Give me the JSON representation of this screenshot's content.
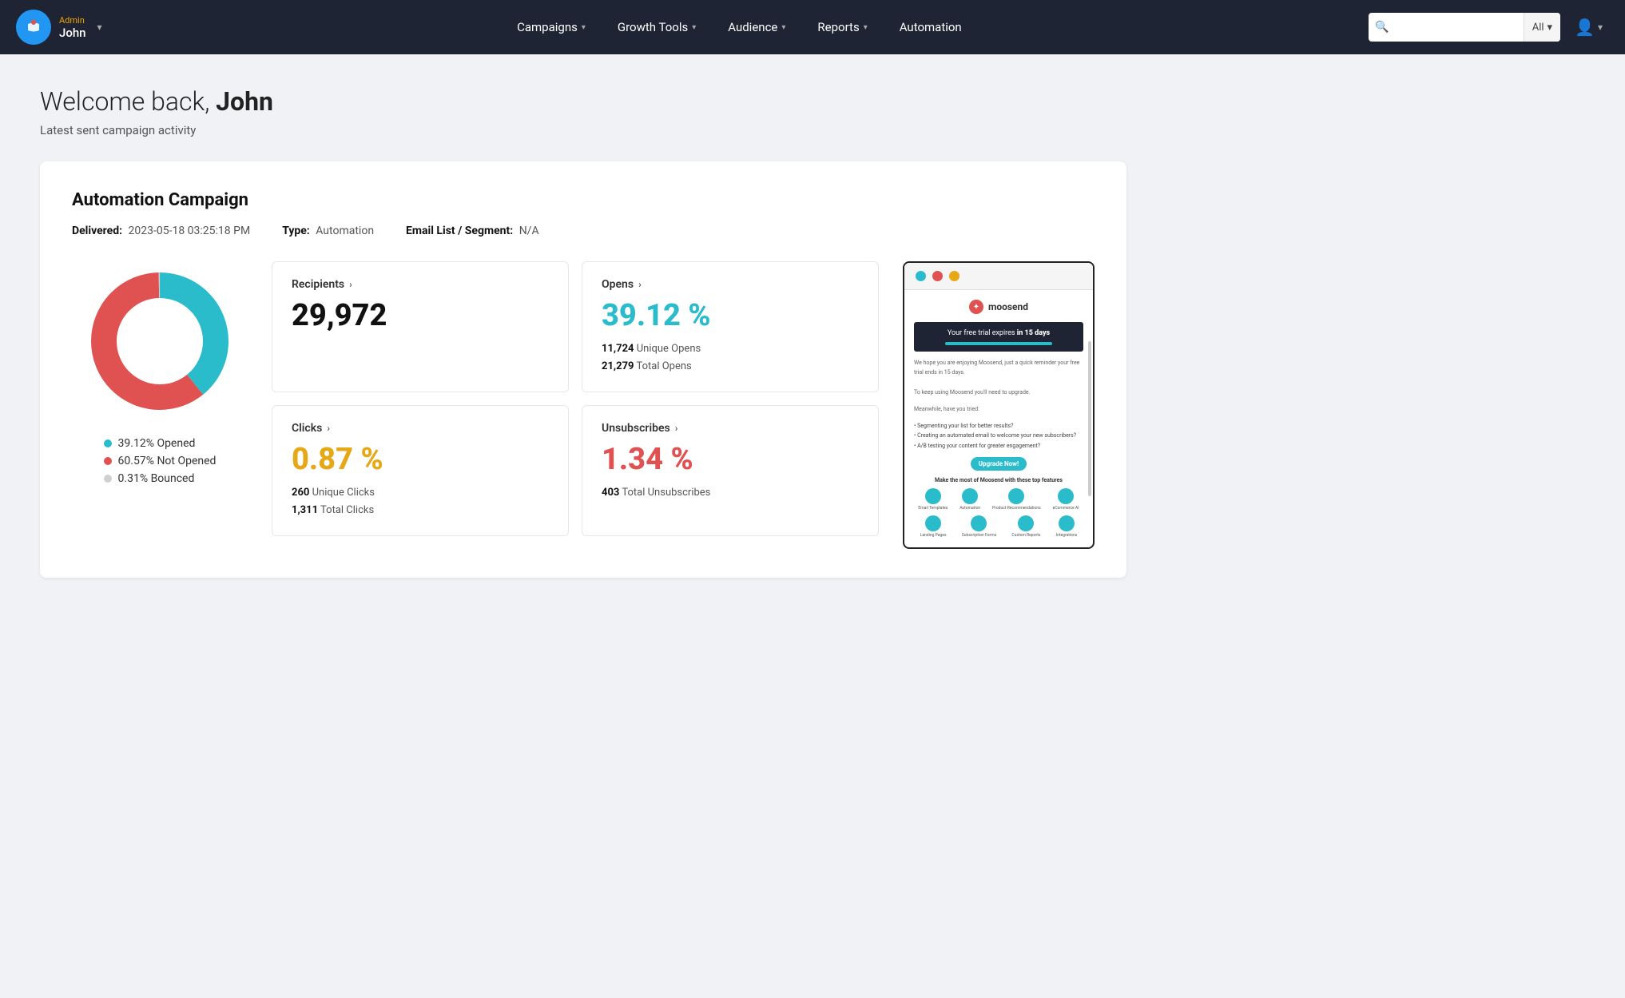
{
  "navbar": {
    "logo_emoji": "🎩",
    "admin_label": "Admin",
    "username": "John",
    "user_dropdown_char": "▾",
    "nav_items": [
      {
        "label": "Campaigns",
        "has_dropdown": true
      },
      {
        "label": "Growth Tools",
        "has_dropdown": true
      },
      {
        "label": "Audience",
        "has_dropdown": true
      },
      {
        "label": "Reports",
        "has_dropdown": true
      },
      {
        "label": "Automation",
        "has_dropdown": false
      }
    ],
    "search_placeholder": "",
    "search_filter": "All",
    "profile_icon": "👤"
  },
  "page": {
    "welcome_text": "Welcome back, ",
    "welcome_name": "John",
    "subtitle": "Latest sent campaign activity"
  },
  "campaign": {
    "title": "Automation Campaign",
    "delivered_label": "Delivered:",
    "delivered_value": "2023-05-18 03:25:18 PM",
    "type_label": "Type:",
    "type_value": "Automation",
    "email_list_label": "Email List / Segment:",
    "email_list_value": "N/A"
  },
  "donut": {
    "segments": [
      {
        "label": "39.12% Opened",
        "color": "#2bbccc",
        "pct": 39.12
      },
      {
        "label": "60.57% Not Opened",
        "color": "#e05252",
        "pct": 60.57
      },
      {
        "label": "0.31% Bounced",
        "color": "#d0d0d0",
        "pct": 0.31
      }
    ]
  },
  "stats": {
    "recipients": {
      "header": "Recipients",
      "value": "29,972",
      "color": "black"
    },
    "opens": {
      "header": "Opens",
      "value": "39.12 %",
      "color": "teal",
      "sub1_count": "11,724",
      "sub1_label": "Unique Opens",
      "sub2_count": "21,279",
      "sub2_label": "Total Opens"
    },
    "clicks": {
      "header": "Clicks",
      "value": "0.87 %",
      "color": "yellow",
      "sub1_count": "260",
      "sub1_label": "Unique Clicks",
      "sub2_count": "1,311",
      "sub2_label": "Total Clicks"
    },
    "unsubscribes": {
      "header": "Unsubscribes",
      "value": "1.34 %",
      "color": "red",
      "sub1_count": "403",
      "sub1_label": "Total Unsubscribes"
    }
  },
  "email_preview": {
    "dots": [
      "teal",
      "red",
      "yellow"
    ],
    "banner_text": "Your free trial expires in 15 days",
    "body_intro": "We hope you are enjoying Moosend, just a quick reminder your free trial ends in 15 days.",
    "body_line2": "To keep using Moosend you'll need to upgrade.",
    "meanwhile_title": "Meanwhile, have you tried:",
    "bullets": [
      "Segmenting your list for better results?",
      "Creating an automated email to welcome your new subscribers?",
      "A/B testing your content for greater engagement?"
    ],
    "upgrade_btn": "Upgrade Now!",
    "features_title": "Make the most of Moosend with these top features",
    "feature_labels": [
      "Email Templates",
      "Automation",
      "Product Recommendations",
      "eCommerce AI",
      "Landing Pages",
      "Subscription Forms",
      "Custom Reports",
      "Integrations"
    ]
  }
}
